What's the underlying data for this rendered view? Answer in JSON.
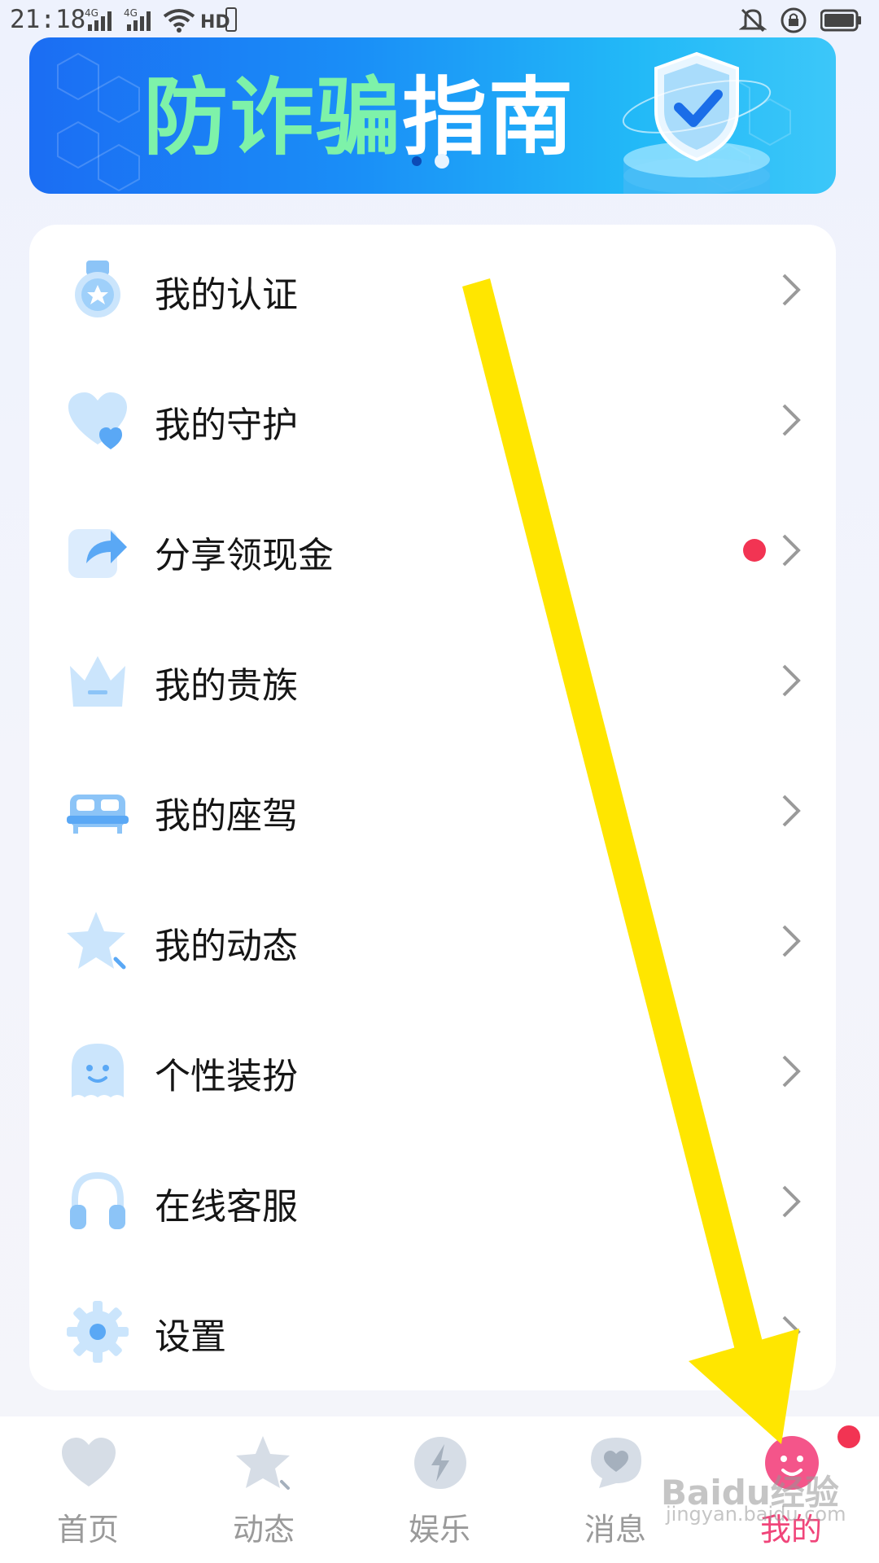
{
  "status_bar": {
    "time": "21:18",
    "network_1": "4G",
    "network_2": "4G",
    "hd": "HD",
    "icons": [
      "signal-icon",
      "signal-icon",
      "wifi-icon",
      "hd-icon",
      "mute-icon",
      "lock-rotation-icon",
      "battery-icon"
    ]
  },
  "banner": {
    "title_green": "防诈骗",
    "title_white": "指南",
    "icon": "shield-check-icon",
    "dots": 2,
    "active_dot": 2
  },
  "menu": {
    "items": [
      {
        "label": "我的认证",
        "icon": "medal-icon"
      },
      {
        "label": "我的守护",
        "icon": "heart-icon"
      },
      {
        "label": "分享领现金",
        "icon": "share-icon",
        "badge": true
      },
      {
        "label": "我的贵族",
        "icon": "crown-icon"
      },
      {
        "label": "我的座驾",
        "icon": "car-icon"
      },
      {
        "label": "我的动态",
        "icon": "star-icon"
      },
      {
        "label": "个性装扮",
        "icon": "ghost-face-icon"
      },
      {
        "label": "在线客服",
        "icon": "headphones-icon"
      },
      {
        "label": "设置",
        "icon": "gear-icon"
      }
    ]
  },
  "bottom_nav": {
    "items": [
      {
        "label": "首页",
        "icon": "heart-icon"
      },
      {
        "label": "动态",
        "icon": "star-icon"
      },
      {
        "label": "娱乐",
        "icon": "lightning-icon"
      },
      {
        "label": "消息",
        "icon": "message-heart-icon"
      },
      {
        "label": "我的",
        "icon": "smile-face-icon",
        "active": true,
        "badge": true
      }
    ]
  },
  "colors": {
    "accent_pink": "#f0457a",
    "badge_red": "#f23453",
    "icon_blue": "#5aa8f5",
    "annotation_yellow": "#ffe600"
  },
  "watermark": {
    "text": "Baidu经验",
    "sub": "jingyan.baidu.com"
  }
}
